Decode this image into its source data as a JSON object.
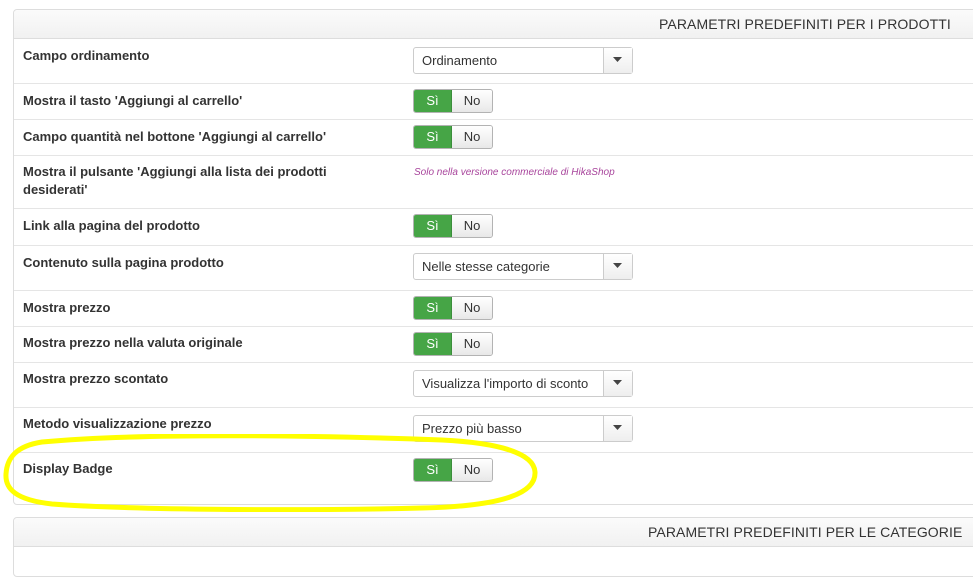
{
  "products_panel": {
    "title": "PARAMETRI PREDEFINITI PER I PRODOTTI",
    "rows": [
      {
        "label": "Campo ordinamento",
        "control": "select",
        "value": "Ordinamento"
      },
      {
        "label": "Mostra il tasto 'Aggiungi al carrello'",
        "control": "toggle",
        "yes": "Sì",
        "no": "No",
        "value": "yes"
      },
      {
        "label": "Campo quantità nel bottone 'Aggiungi al carrello'",
        "control": "toggle",
        "yes": "Sì",
        "no": "No",
        "value": "yes"
      },
      {
        "label": "Mostra il pulsante 'Aggiungi alla lista dei prodotti desiderati'",
        "control": "note",
        "note": "Solo nella versione commerciale di HikaShop"
      },
      {
        "label": "Link alla pagina del prodotto",
        "control": "toggle",
        "yes": "Sì",
        "no": "No",
        "value": "yes"
      },
      {
        "label": "Contenuto sulla pagina prodotto",
        "control": "select",
        "value": "Nelle stesse categorie"
      },
      {
        "label": "Mostra prezzo",
        "control": "toggle",
        "yes": "Sì",
        "no": "No",
        "value": "yes"
      },
      {
        "label": "Mostra prezzo nella valuta originale",
        "control": "toggle",
        "yes": "Sì",
        "no": "No",
        "value": "yes"
      },
      {
        "label": "Mostra prezzo scontato",
        "control": "select",
        "value": "Visualizza l'importo di sconto"
      },
      {
        "label": "Metodo visualizzazione prezzo",
        "control": "select",
        "value": "Prezzo più basso"
      },
      {
        "label": "Display Badge",
        "control": "toggle",
        "yes": "Sì",
        "no": "No",
        "value": "yes"
      }
    ]
  },
  "categories_panel": {
    "title": "PARAMETRI PREDEFINITI PER LE CATEGORIE"
  },
  "colors": {
    "toggle_active": "#46a546",
    "note_text": "#a8459c",
    "highlight": "#ffff00"
  }
}
